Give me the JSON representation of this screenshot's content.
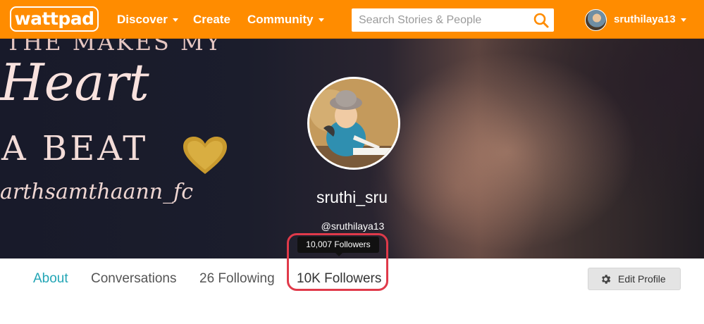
{
  "header": {
    "logo": "wattpad",
    "nav": {
      "discover": "Discover",
      "create": "Create",
      "community": "Community"
    },
    "search": {
      "placeholder": "Search Stories & People",
      "icon": "search-icon"
    },
    "user": {
      "username": "sruthilaya13",
      "avatar_icon": "avatar"
    }
  },
  "cover": {
    "line1": "THE MAKES MY",
    "heart_word": "Heart",
    "line3": "A BEAT",
    "credit": "arthsamthaann_fc"
  },
  "profile": {
    "display_name": "sruthi_sru",
    "handle": "@sruthilaya13",
    "followers_tooltip": "10,007 Followers"
  },
  "tabs": {
    "about": "About",
    "conversations": "Conversations",
    "following": "26 Following",
    "followers": "10K Followers"
  },
  "actions": {
    "edit_profile": "Edit Profile"
  },
  "colors": {
    "brand_orange": "#ff8c00",
    "active_tab": "#22a5b5",
    "highlight": "#e03a4a"
  }
}
